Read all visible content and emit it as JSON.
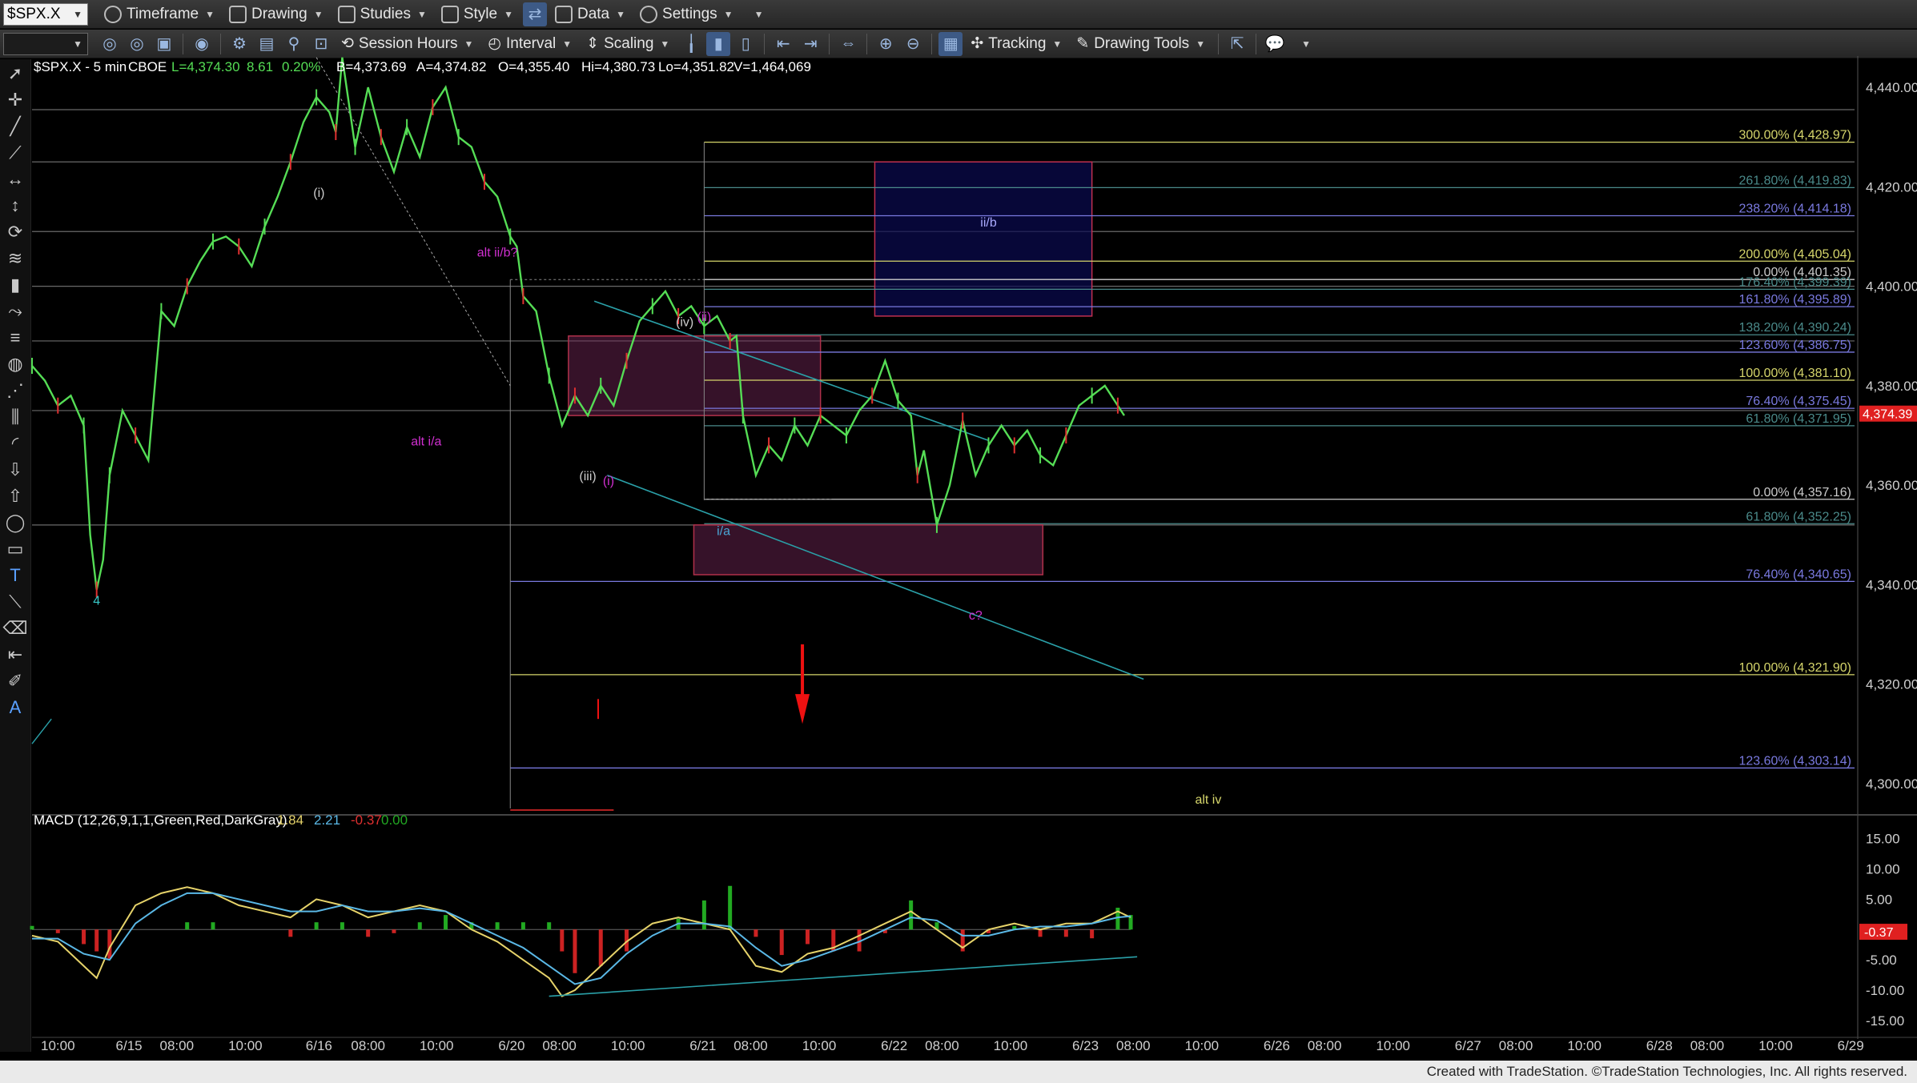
{
  "toolbar1": {
    "symbol": "$SPX.X",
    "items": [
      {
        "label": "Timeframe",
        "icon": "clock-icon"
      },
      {
        "label": "Drawing",
        "icon": "pencil-icon"
      },
      {
        "label": "Studies",
        "icon": "studies-icon"
      },
      {
        "label": "Style",
        "icon": "style-icon"
      },
      {
        "label": "Data",
        "icon": "data-icon"
      },
      {
        "label": "Settings",
        "icon": "gear-icon"
      }
    ]
  },
  "toolbar2": {
    "session_hours": "Session Hours",
    "interval": "Interval",
    "scaling": "Scaling",
    "tracking": "Tracking",
    "drawing_tools": "Drawing Tools"
  },
  "chart_header": {
    "symbol_info": "$SPX.X - 5 min",
    "exchange": "CBOE",
    "last": "L=4,374.30",
    "change": "8.61",
    "pct": "0.20%",
    "bid": "B=4,373.69",
    "ask": "A=4,374.82",
    "open": "O=4,355.40",
    "high": "Hi=4,380.73",
    "low": "Lo=4,351.82",
    "volume": "V=1,464,069"
  },
  "macd_header": {
    "title": "MACD (12,26,9,1,1,Green,Red,DarkGray)",
    "v1": "1.84",
    "v2": "2.21",
    "v3": "-0.37",
    "v4": "0.00"
  },
  "chart_data": {
    "type": "line",
    "price_axis": {
      "min": 4295,
      "max": 4445,
      "ticks": [
        4300,
        4320,
        4340,
        4360,
        4380,
        4400,
        4420,
        4440
      ]
    },
    "price_tick_labels": [
      "4,300.00",
      "4,320.00",
      "4,340.00",
      "4,360.00",
      "4,380.00",
      "4,400.00",
      "4,420.00",
      "4,440.00"
    ],
    "last_price_label": "4,374.39",
    "macd_axis": {
      "min": -17,
      "max": 18,
      "ticks": [
        15,
        10,
        5,
        -5,
        -10,
        -15
      ]
    },
    "macd_tick_labels": [
      "15.00",
      "10.00",
      "5.00",
      "-5.00",
      "-10.00",
      "-15.00"
    ],
    "macd_last_label": "-0.37",
    "time_labels": [
      {
        "t": 0.02,
        "label": "10:00"
      },
      {
        "t": 0.075,
        "label": "6/15"
      },
      {
        "t": 0.112,
        "label": "08:00"
      },
      {
        "t": 0.165,
        "label": "10:00"
      },
      {
        "t": 0.222,
        "label": "6/16"
      },
      {
        "t": 0.26,
        "label": "08:00"
      },
      {
        "t": 0.313,
        "label": "10:00"
      },
      {
        "t": 0.371,
        "label": "6/20"
      },
      {
        "t": 0.408,
        "label": "08:00"
      },
      {
        "t": 0.461,
        "label": "10:00"
      },
      {
        "t": 0.519,
        "label": "6/21"
      },
      {
        "t": 0.556,
        "label": "08:00"
      },
      {
        "t": 0.609,
        "label": "10:00"
      },
      {
        "t": 0.667,
        "label": "6/22"
      },
      {
        "t": 0.704,
        "label": "08:00"
      },
      {
        "t": 0.757,
        "label": "10:00"
      },
      {
        "t": 0.815,
        "label": "6/23"
      },
      {
        "t": 0.852,
        "label": "08:00"
      },
      {
        "t": 0.905,
        "label": "10:00"
      },
      {
        "t": 0.963,
        "label": "6/26"
      },
      {
        "t": 1.0,
        "label": "08:00"
      },
      {
        "t": 1.053,
        "label": "10:00"
      },
      {
        "t": 1.111,
        "label": "6/27"
      },
      {
        "t": 1.148,
        "label": "08:00"
      },
      {
        "t": 1.201,
        "label": "10:00"
      },
      {
        "t": 1.259,
        "label": "6/28"
      },
      {
        "t": 1.296,
        "label": "08:00"
      },
      {
        "t": 1.349,
        "label": "10:00"
      },
      {
        "t": 1.407,
        "label": "6/29"
      }
    ],
    "price_path": [
      [
        0.0,
        4384
      ],
      [
        0.01,
        4381
      ],
      [
        0.02,
        4376
      ],
      [
        0.03,
        4378
      ],
      [
        0.04,
        4372
      ],
      [
        0.045,
        4350
      ],
      [
        0.05,
        4339
      ],
      [
        0.055,
        4345
      ],
      [
        0.06,
        4362
      ],
      [
        0.07,
        4375
      ],
      [
        0.08,
        4370
      ],
      [
        0.09,
        4365
      ],
      [
        0.1,
        4395
      ],
      [
        0.11,
        4392
      ],
      [
        0.12,
        4400
      ],
      [
        0.13,
        4405
      ],
      [
        0.14,
        4409
      ],
      [
        0.15,
        4410
      ],
      [
        0.16,
        4408
      ],
      [
        0.17,
        4404
      ],
      [
        0.18,
        4412
      ],
      [
        0.19,
        4418
      ],
      [
        0.2,
        4425
      ],
      [
        0.21,
        4433
      ],
      [
        0.22,
        4438
      ],
      [
        0.23,
        4435
      ],
      [
        0.235,
        4431
      ],
      [
        0.24,
        4446
      ],
      [
        0.25,
        4428
      ],
      [
        0.26,
        4440
      ],
      [
        0.27,
        4430
      ],
      [
        0.28,
        4423
      ],
      [
        0.29,
        4432
      ],
      [
        0.3,
        4426
      ],
      [
        0.31,
        4436
      ],
      [
        0.32,
        4440
      ],
      [
        0.33,
        4430
      ],
      [
        0.34,
        4428
      ],
      [
        0.35,
        4421
      ],
      [
        0.36,
        4418
      ],
      [
        0.37,
        4410
      ],
      [
        0.375,
        4408
      ],
      [
        0.38,
        4398
      ],
      [
        0.39,
        4395
      ],
      [
        0.4,
        4382
      ],
      [
        0.41,
        4372
      ],
      [
        0.42,
        4378
      ],
      [
        0.43,
        4374
      ],
      [
        0.44,
        4380
      ],
      [
        0.45,
        4376
      ],
      [
        0.46,
        4385
      ],
      [
        0.47,
        4393
      ],
      [
        0.48,
        4396
      ],
      [
        0.49,
        4399
      ],
      [
        0.5,
        4394
      ],
      [
        0.51,
        4396
      ],
      [
        0.52,
        4392
      ],
      [
        0.53,
        4394
      ],
      [
        0.54,
        4389
      ],
      [
        0.545,
        4390
      ],
      [
        0.55,
        4374
      ],
      [
        0.56,
        4362
      ],
      [
        0.57,
        4368
      ],
      [
        0.58,
        4365
      ],
      [
        0.59,
        4372
      ],
      [
        0.6,
        4368
      ],
      [
        0.61,
        4374
      ],
      [
        0.62,
        4372
      ],
      [
        0.63,
        4370
      ],
      [
        0.64,
        4375
      ],
      [
        0.65,
        4378
      ],
      [
        0.66,
        4385
      ],
      [
        0.67,
        4377
      ],
      [
        0.68,
        4374
      ],
      [
        0.685,
        4362
      ],
      [
        0.69,
        4367
      ],
      [
        0.7,
        4352
      ],
      [
        0.71,
        4360
      ],
      [
        0.72,
        4373
      ],
      [
        0.73,
        4362
      ],
      [
        0.74,
        4368
      ],
      [
        0.75,
        4372
      ],
      [
        0.76,
        4368
      ],
      [
        0.77,
        4371
      ],
      [
        0.78,
        4366
      ],
      [
        0.79,
        4364
      ],
      [
        0.8,
        4370
      ],
      [
        0.81,
        4376
      ],
      [
        0.82,
        4378
      ],
      [
        0.83,
        4380
      ],
      [
        0.84,
        4376
      ],
      [
        0.845,
        4374
      ]
    ],
    "macd_path": [
      [
        0.0,
        -1
      ],
      [
        0.02,
        -2
      ],
      [
        0.04,
        -6
      ],
      [
        0.05,
        -8
      ],
      [
        0.06,
        -3
      ],
      [
        0.08,
        4
      ],
      [
        0.1,
        6
      ],
      [
        0.12,
        7
      ],
      [
        0.14,
        6
      ],
      [
        0.16,
        4
      ],
      [
        0.18,
        3
      ],
      [
        0.2,
        2
      ],
      [
        0.22,
        5
      ],
      [
        0.24,
        4
      ],
      [
        0.26,
        2
      ],
      [
        0.28,
        3
      ],
      [
        0.3,
        4
      ],
      [
        0.32,
        3
      ],
      [
        0.34,
        0
      ],
      [
        0.36,
        -2
      ],
      [
        0.38,
        -5
      ],
      [
        0.4,
        -8
      ],
      [
        0.41,
        -11
      ],
      [
        0.42,
        -10
      ],
      [
        0.44,
        -6
      ],
      [
        0.46,
        -2
      ],
      [
        0.48,
        1
      ],
      [
        0.5,
        2
      ],
      [
        0.52,
        1
      ],
      [
        0.54,
        0
      ],
      [
        0.56,
        -6
      ],
      [
        0.58,
        -7
      ],
      [
        0.6,
        -4
      ],
      [
        0.62,
        -3
      ],
      [
        0.64,
        -1
      ],
      [
        0.66,
        1
      ],
      [
        0.68,
        3
      ],
      [
        0.7,
        0
      ],
      [
        0.72,
        -3
      ],
      [
        0.74,
        0
      ],
      [
        0.76,
        1
      ],
      [
        0.78,
        0
      ],
      [
        0.8,
        1
      ],
      [
        0.82,
        1
      ],
      [
        0.84,
        3
      ],
      [
        0.85,
        2
      ]
    ],
    "signal_path": [
      [
        0.0,
        -1.5
      ],
      [
        0.02,
        -1.5
      ],
      [
        0.04,
        -4
      ],
      [
        0.06,
        -5
      ],
      [
        0.08,
        1
      ],
      [
        0.1,
        4
      ],
      [
        0.12,
        6
      ],
      [
        0.14,
        6
      ],
      [
        0.16,
        5
      ],
      [
        0.18,
        4
      ],
      [
        0.2,
        3
      ],
      [
        0.22,
        3
      ],
      [
        0.24,
        4
      ],
      [
        0.26,
        3
      ],
      [
        0.28,
        3
      ],
      [
        0.3,
        3.5
      ],
      [
        0.32,
        3
      ],
      [
        0.34,
        1
      ],
      [
        0.36,
        -1
      ],
      [
        0.38,
        -3
      ],
      [
        0.4,
        -6
      ],
      [
        0.42,
        -9
      ],
      [
        0.44,
        -8
      ],
      [
        0.46,
        -4
      ],
      [
        0.48,
        -1
      ],
      [
        0.5,
        1
      ],
      [
        0.52,
        1
      ],
      [
        0.54,
        0.5
      ],
      [
        0.56,
        -3
      ],
      [
        0.58,
        -6
      ],
      [
        0.6,
        -5
      ],
      [
        0.62,
        -3.5
      ],
      [
        0.64,
        -2
      ],
      [
        0.66,
        0
      ],
      [
        0.68,
        2
      ],
      [
        0.7,
        1.5
      ],
      [
        0.72,
        -1
      ],
      [
        0.74,
        -1
      ],
      [
        0.76,
        0
      ],
      [
        0.78,
        0.5
      ],
      [
        0.8,
        0.5
      ],
      [
        0.82,
        1
      ],
      [
        0.84,
        2
      ],
      [
        0.85,
        2.2
      ]
    ],
    "fib_upper": [
      {
        "level": 4428.97,
        "label": "300.00% (4,428.97)",
        "color": "#d6d66b"
      },
      {
        "level": 4419.83,
        "label": "261.80% (4,419.83)",
        "color": "#4a8a8a"
      },
      {
        "level": 4414.18,
        "label": "238.20% (4,414.18)",
        "color": "#7a7ae0"
      },
      {
        "level": 4405.04,
        "label": "200.00% (4,405.04)",
        "color": "#d6d66b"
      },
      {
        "level": 4401.35,
        "label": "0.00% (4,401.35)",
        "color": "#cccccc"
      },
      {
        "level": 4399.39,
        "label": "176.40% (4,399.39)",
        "color": "#4a8a8a"
      },
      {
        "level": 4395.89,
        "label": "161.80% (4,395.89)",
        "color": "#7a7ae0"
      },
      {
        "level": 4390.24,
        "label": "138.20% (4,390.24)",
        "color": "#4a8a8a"
      },
      {
        "level": 4386.75,
        "label": "123.60% (4,386.75)",
        "color": "#7a7ae0"
      },
      {
        "level": 4381.1,
        "label": "100.00% (4,381.10)",
        "color": "#d6d66b"
      },
      {
        "level": 4375.45,
        "label": "76.40% (4,375.45)",
        "color": "#7a7ae0"
      },
      {
        "level": 4371.95,
        "label": "61.80% (4,371.95)",
        "color": "#4a8a8a"
      },
      {
        "level": 4357.16,
        "label": "0.00% (4,357.16)",
        "color": "#cccccc"
      },
      {
        "level": 4352.25,
        "label": "61.80% (4,352.25)",
        "color": "#4a8a8a"
      },
      {
        "level": 4340.65,
        "label": "76.40% (4,340.65)",
        "color": "#7a7ae0"
      },
      {
        "level": 4321.9,
        "label": "100.00% (4,321.90)",
        "color": "#d6d66b"
      },
      {
        "level": 4303.14,
        "label": "123.60% (4,303.14)",
        "color": "#7a7ae0"
      }
    ],
    "horizontal_lines": [
      4435.5,
      4425,
      4411,
      4400,
      4389,
      4375,
      4352
    ],
    "wave_labels": [
      {
        "text": "4",
        "t": 0.05,
        "p": 4336,
        "color": "#38c9c9"
      },
      {
        "text": "(i)",
        "t": 0.222,
        "p": 4418,
        "color": "#cccccc"
      },
      {
        "text": "alt ii/b?",
        "t": 0.36,
        "p": 4406,
        "color": "#d02fd0"
      },
      {
        "text": "alt i/a",
        "t": 0.305,
        "p": 4368,
        "color": "#d02fd0"
      },
      {
        "text": "(iii)",
        "t": 0.43,
        "p": 4361,
        "color": "#cccccc"
      },
      {
        "text": "(i)",
        "t": 0.446,
        "p": 4360,
        "color": "#d02fd0"
      },
      {
        "text": "(iv)",
        "t": 0.505,
        "p": 4392,
        "color": "#cccccc"
      },
      {
        "text": "(ii)",
        "t": 0.52,
        "p": 4393,
        "color": "#d02fd0"
      },
      {
        "text": "i/a",
        "t": 0.535,
        "p": 4350,
        "color": "#4aa6d6"
      },
      {
        "text": "ii/b",
        "t": 0.74,
        "p": 4412,
        "color": "#aaaaff"
      },
      {
        "text": "c?",
        "t": 0.73,
        "p": 4333,
        "color": "#d02fd0"
      },
      {
        "text": "alt iv",
        "t": 0.91,
        "p": 4296,
        "color": "#d6d66b"
      }
    ],
    "boxes": [
      {
        "t1": 0.415,
        "t2": 0.61,
        "p1": 4390,
        "p2": 4374,
        "fill": "rgba(120,40,90,0.45)",
        "stroke": "#b0304a"
      },
      {
        "t1": 0.512,
        "t2": 0.782,
        "p1": 4352,
        "p2": 4342,
        "fill": "rgba(120,40,90,0.45)",
        "stroke": "#b0304a"
      },
      {
        "t1": 0.652,
        "t2": 0.82,
        "p1": 4425,
        "p2": 4394,
        "fill": "rgba(10,10,80,0.7)",
        "stroke": "#c03050"
      }
    ]
  },
  "footer": "Created with TradeStation. ©TradeStation Technologies, Inc. All rights reserved."
}
